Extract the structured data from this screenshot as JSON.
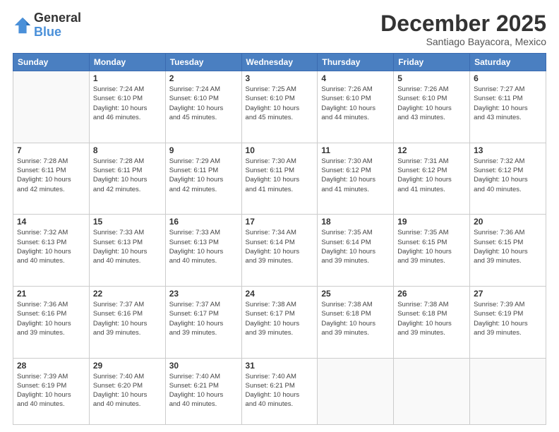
{
  "logo": {
    "general": "General",
    "blue": "Blue"
  },
  "header": {
    "month": "December 2025",
    "location": "Santiago Bayacora, Mexico"
  },
  "weekdays": [
    "Sunday",
    "Monday",
    "Tuesday",
    "Wednesday",
    "Thursday",
    "Friday",
    "Saturday"
  ],
  "weeks": [
    [
      {
        "day": "",
        "info": ""
      },
      {
        "day": "1",
        "info": "Sunrise: 7:24 AM\nSunset: 6:10 PM\nDaylight: 10 hours\nand 46 minutes."
      },
      {
        "day": "2",
        "info": "Sunrise: 7:24 AM\nSunset: 6:10 PM\nDaylight: 10 hours\nand 45 minutes."
      },
      {
        "day": "3",
        "info": "Sunrise: 7:25 AM\nSunset: 6:10 PM\nDaylight: 10 hours\nand 45 minutes."
      },
      {
        "day": "4",
        "info": "Sunrise: 7:26 AM\nSunset: 6:10 PM\nDaylight: 10 hours\nand 44 minutes."
      },
      {
        "day": "5",
        "info": "Sunrise: 7:26 AM\nSunset: 6:10 PM\nDaylight: 10 hours\nand 43 minutes."
      },
      {
        "day": "6",
        "info": "Sunrise: 7:27 AM\nSunset: 6:11 PM\nDaylight: 10 hours\nand 43 minutes."
      }
    ],
    [
      {
        "day": "7",
        "info": "Sunrise: 7:28 AM\nSunset: 6:11 PM\nDaylight: 10 hours\nand 42 minutes."
      },
      {
        "day": "8",
        "info": "Sunrise: 7:28 AM\nSunset: 6:11 PM\nDaylight: 10 hours\nand 42 minutes."
      },
      {
        "day": "9",
        "info": "Sunrise: 7:29 AM\nSunset: 6:11 PM\nDaylight: 10 hours\nand 42 minutes."
      },
      {
        "day": "10",
        "info": "Sunrise: 7:30 AM\nSunset: 6:11 PM\nDaylight: 10 hours\nand 41 minutes."
      },
      {
        "day": "11",
        "info": "Sunrise: 7:30 AM\nSunset: 6:12 PM\nDaylight: 10 hours\nand 41 minutes."
      },
      {
        "day": "12",
        "info": "Sunrise: 7:31 AM\nSunset: 6:12 PM\nDaylight: 10 hours\nand 41 minutes."
      },
      {
        "day": "13",
        "info": "Sunrise: 7:32 AM\nSunset: 6:12 PM\nDaylight: 10 hours\nand 40 minutes."
      }
    ],
    [
      {
        "day": "14",
        "info": "Sunrise: 7:32 AM\nSunset: 6:13 PM\nDaylight: 10 hours\nand 40 minutes."
      },
      {
        "day": "15",
        "info": "Sunrise: 7:33 AM\nSunset: 6:13 PM\nDaylight: 10 hours\nand 40 minutes."
      },
      {
        "day": "16",
        "info": "Sunrise: 7:33 AM\nSunset: 6:13 PM\nDaylight: 10 hours\nand 40 minutes."
      },
      {
        "day": "17",
        "info": "Sunrise: 7:34 AM\nSunset: 6:14 PM\nDaylight: 10 hours\nand 39 minutes."
      },
      {
        "day": "18",
        "info": "Sunrise: 7:35 AM\nSunset: 6:14 PM\nDaylight: 10 hours\nand 39 minutes."
      },
      {
        "day": "19",
        "info": "Sunrise: 7:35 AM\nSunset: 6:15 PM\nDaylight: 10 hours\nand 39 minutes."
      },
      {
        "day": "20",
        "info": "Sunrise: 7:36 AM\nSunset: 6:15 PM\nDaylight: 10 hours\nand 39 minutes."
      }
    ],
    [
      {
        "day": "21",
        "info": "Sunrise: 7:36 AM\nSunset: 6:16 PM\nDaylight: 10 hours\nand 39 minutes."
      },
      {
        "day": "22",
        "info": "Sunrise: 7:37 AM\nSunset: 6:16 PM\nDaylight: 10 hours\nand 39 minutes."
      },
      {
        "day": "23",
        "info": "Sunrise: 7:37 AM\nSunset: 6:17 PM\nDaylight: 10 hours\nand 39 minutes."
      },
      {
        "day": "24",
        "info": "Sunrise: 7:38 AM\nSunset: 6:17 PM\nDaylight: 10 hours\nand 39 minutes."
      },
      {
        "day": "25",
        "info": "Sunrise: 7:38 AM\nSunset: 6:18 PM\nDaylight: 10 hours\nand 39 minutes."
      },
      {
        "day": "26",
        "info": "Sunrise: 7:38 AM\nSunset: 6:18 PM\nDaylight: 10 hours\nand 39 minutes."
      },
      {
        "day": "27",
        "info": "Sunrise: 7:39 AM\nSunset: 6:19 PM\nDaylight: 10 hours\nand 39 minutes."
      }
    ],
    [
      {
        "day": "28",
        "info": "Sunrise: 7:39 AM\nSunset: 6:19 PM\nDaylight: 10 hours\nand 40 minutes."
      },
      {
        "day": "29",
        "info": "Sunrise: 7:40 AM\nSunset: 6:20 PM\nDaylight: 10 hours\nand 40 minutes."
      },
      {
        "day": "30",
        "info": "Sunrise: 7:40 AM\nSunset: 6:21 PM\nDaylight: 10 hours\nand 40 minutes."
      },
      {
        "day": "31",
        "info": "Sunrise: 7:40 AM\nSunset: 6:21 PM\nDaylight: 10 hours\nand 40 minutes."
      },
      {
        "day": "",
        "info": ""
      },
      {
        "day": "",
        "info": ""
      },
      {
        "day": "",
        "info": ""
      }
    ]
  ]
}
